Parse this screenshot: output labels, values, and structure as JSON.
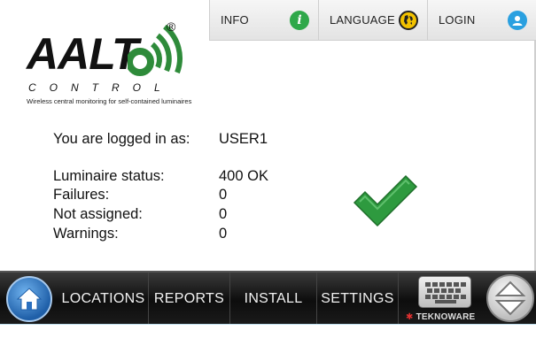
{
  "header": {
    "tabs": [
      {
        "label": "INFO",
        "icon": "info-icon"
      },
      {
        "label": "LANGUAGE",
        "icon": "globe-icon"
      },
      {
        "label": "LOGIN",
        "icon": "user-icon"
      }
    ]
  },
  "logo": {
    "word": "AALT",
    "subtitle": "CONTROL",
    "registered": "®",
    "tagline": "Wireless central monitoring for self-contained luminaires"
  },
  "status": {
    "logged_in_label": "You are logged in as:",
    "logged_in_value": "USER1",
    "luminaire_label": "Luminaire status:",
    "luminaire_value": "400 OK",
    "failures_label": "Failures:",
    "failures_value": "0",
    "not_assigned_label": "Not assigned:",
    "not_assigned_value": "0",
    "warnings_label": "Warnings:",
    "warnings_value": "0",
    "indicator": "checkmark-icon"
  },
  "nav": {
    "home_icon": "home-icon",
    "items": [
      "LOCATIONS",
      "REPORTS",
      "INSTALL",
      "SETTINGS"
    ],
    "keyboard_icon": "keyboard-icon",
    "brand": "TEKNOWARE",
    "scroll_icon": "scroll-updown-icon"
  },
  "colors": {
    "accent_green": "#2e9a3f",
    "topbar": "#eaeaea",
    "navbar": "#111111",
    "home_blue": "#2a6fbf"
  }
}
